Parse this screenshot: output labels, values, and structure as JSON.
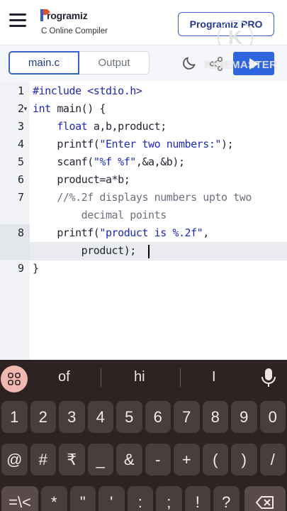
{
  "header": {
    "brand": "rogramiz",
    "subtitle": "C Online Compiler",
    "pro_label": "Programiz PRO"
  },
  "tabs": {
    "main": "main.c",
    "output": "Output"
  },
  "run_label": "Run",
  "watermark": {
    "text": "KINEMASTER",
    "letter": "K"
  },
  "editor": {
    "line_numbers": [
      "1",
      "2",
      "3",
      "4",
      "5",
      "6",
      "7",
      "",
      "8",
      "",
      "9"
    ],
    "lines": [
      "#include <stdio.h>",
      "int main() {",
      "    float a,b,product;",
      "    printf(\"Enter two numbers:\");",
      "    scanf(\"%f %f\",&a,&b);",
      "    product=a*b;",
      "    //%.2f displays numbers upto two",
      "        decimal points",
      "    printf(\"product is %.2f\",",
      "        product);",
      "}"
    ]
  },
  "keyboard": {
    "suggestions": [
      "of",
      "hi",
      "I"
    ],
    "row_numbers": [
      "1",
      "2",
      "3",
      "4",
      "5",
      "6",
      "7",
      "8",
      "9",
      "0"
    ],
    "row_symbols": [
      "@",
      "#",
      "₹",
      "_",
      "&",
      "-",
      "+",
      "(",
      ")",
      "/"
    ],
    "row_bottom": [
      "=\\<",
      "*",
      "\"",
      "'",
      ":",
      ";",
      "!",
      "?"
    ]
  },
  "colors": {
    "accent": "#2f66e0",
    "keyboard_bg": "#2d2323",
    "key_bg": "#4a3d3d"
  }
}
